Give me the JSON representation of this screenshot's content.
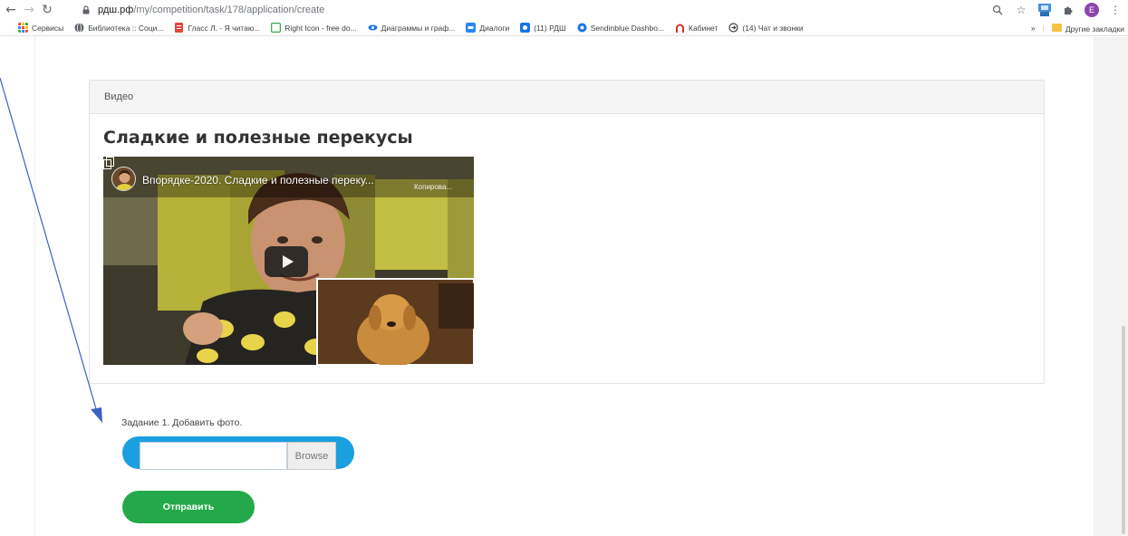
{
  "browser": {
    "url_host": "рдш.рф",
    "url_path": "/my/competition/task/178/application/create",
    "avatar_letter": "E",
    "bookmarks": [
      {
        "label": "Сервисы",
        "icon": "apps-grid-icon",
        "color": "#e8453c"
      },
      {
        "label": "Библиотека :: Соци...",
        "icon": "globe-icon",
        "color": "#5f6368"
      },
      {
        "label": "Гласс Л. - Я читаю...",
        "icon": "document-icon",
        "color": "#e8453c"
      },
      {
        "label": "Right Icon - free do...",
        "icon": "square-icon",
        "color": "#34a853"
      },
      {
        "label": "Диаграммы и граф...",
        "icon": "eye-icon",
        "color": "#1a73e8"
      },
      {
        "label": "Диалоги",
        "icon": "vk-icon",
        "color": "#2787f5"
      },
      {
        "label": "(11) РДШ",
        "icon": "chat-icon",
        "color": "#1a73e8"
      },
      {
        "label": "Sendinblue Dashbo...",
        "icon": "sendinblue-icon",
        "color": "#1a73e8"
      },
      {
        "label": "Кабинет",
        "icon": "arch-icon",
        "color": "#d93025"
      },
      {
        "label": "(14) Чат и звонки",
        "icon": "circle-arrow-icon",
        "color": "#3c4043"
      }
    ],
    "more_bookmarks": "»",
    "other_bookmarks": "Другие закладки"
  },
  "card": {
    "header": "Видео",
    "title": "Сладкие и полезные перекусы"
  },
  "video": {
    "title": "Впорядке-2020. Сладкие и полезные переку...",
    "copy_label": "Копирова..."
  },
  "form": {
    "task_label": "Задание 1. Добавить фото.",
    "file_value": "",
    "browse_label": "Browse",
    "submit_label": "Отправить"
  },
  "colors": {
    "accent_blue": "#1a9fe0",
    "submit_green": "#23a94a",
    "annotation_arrow": "#3b62c4"
  }
}
